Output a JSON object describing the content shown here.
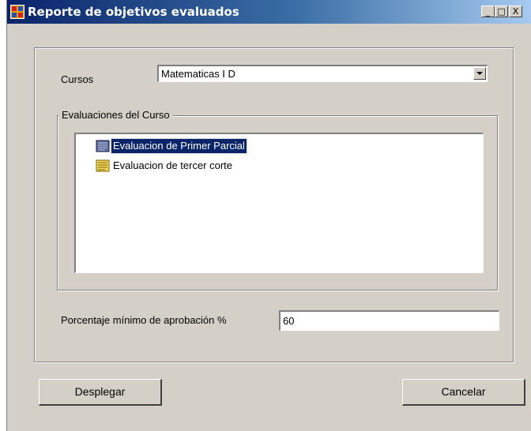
{
  "window": {
    "title": "Reporte de objetivos evaluados",
    "minimize_glyph": "_",
    "maximize_glyph": "□",
    "close_glyph": "X"
  },
  "cursos": {
    "label": "Cursos",
    "selected": "Matematicas I D"
  },
  "evaluaciones": {
    "group_title": "Evaluaciones del Curso",
    "items": [
      {
        "label": "Evaluacion de Primer Parcial",
        "selected": true,
        "icon": "document-icon"
      },
      {
        "label": "Evaluacion de tercer corte",
        "selected": false,
        "icon": "document-icon"
      }
    ]
  },
  "aprobacion": {
    "label": "Porcentaje mínimo de aprobación %",
    "value": "60"
  },
  "buttons": {
    "desplegar": "Desplegar",
    "cancelar": "Cancelar"
  },
  "colors": {
    "titlebar_start": "#0a246a",
    "titlebar_end": "#a6caf0",
    "selection": "#0a246a",
    "face": "#d4d0c8"
  }
}
